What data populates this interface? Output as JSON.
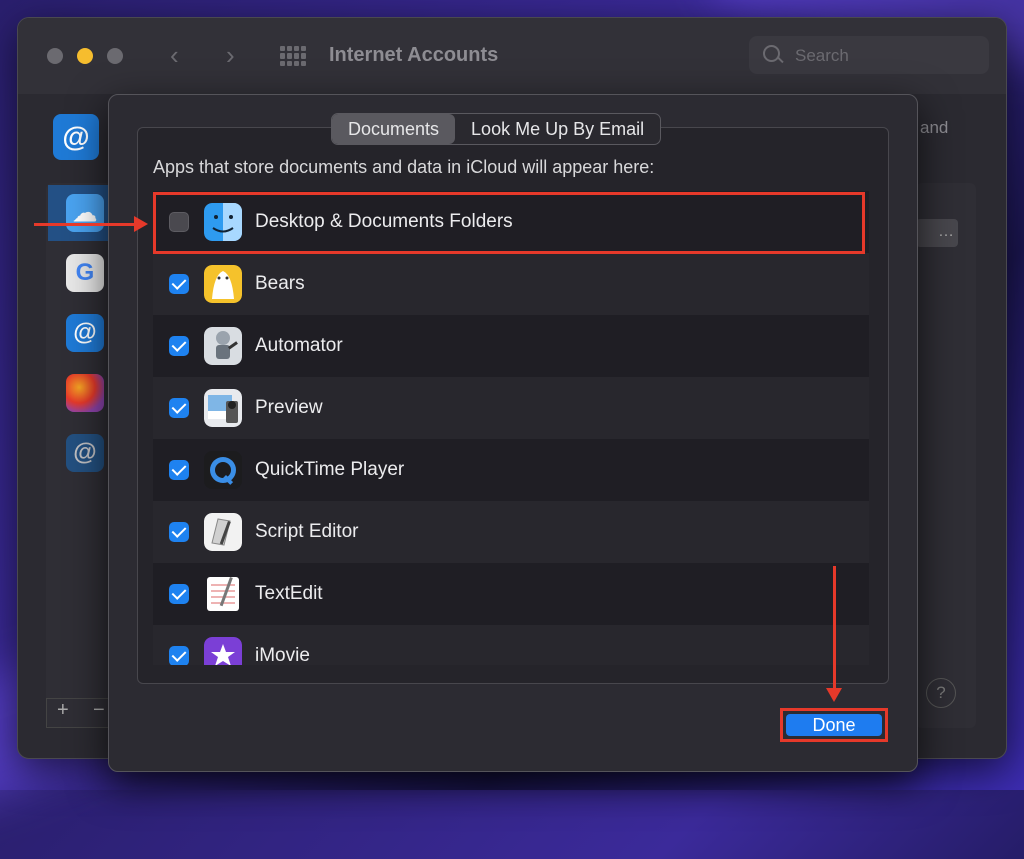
{
  "window": {
    "title": "Internet Accounts",
    "search_placeholder": "Search",
    "background_fragment": "and",
    "add_label": "+",
    "remove_label": "−",
    "help_label": "?",
    "dots_label": "…"
  },
  "sheet": {
    "tabs": [
      {
        "label": "Documents",
        "selected": true
      },
      {
        "label": "Look Me Up By Email",
        "selected": false
      }
    ],
    "description": "Apps that store documents and data in iCloud will appear here:",
    "apps": [
      {
        "label": "Desktop & Documents Folders",
        "checked": false,
        "icon": "finder-icon"
      },
      {
        "label": "Bears",
        "checked": true,
        "icon": "bears-icon"
      },
      {
        "label": "Automator",
        "checked": true,
        "icon": "automator-icon"
      },
      {
        "label": "Preview",
        "checked": true,
        "icon": "preview-icon"
      },
      {
        "label": "QuickTime Player",
        "checked": true,
        "icon": "quicktime-icon"
      },
      {
        "label": "Script Editor",
        "checked": true,
        "icon": "script-editor-icon"
      },
      {
        "label": "TextEdit",
        "checked": true,
        "icon": "textedit-icon"
      },
      {
        "label": "iMovie",
        "checked": true,
        "icon": "imovie-icon"
      }
    ],
    "done_label": "Done"
  },
  "colors": {
    "accent": "#1e82f0",
    "annotation": "#e6392a"
  }
}
